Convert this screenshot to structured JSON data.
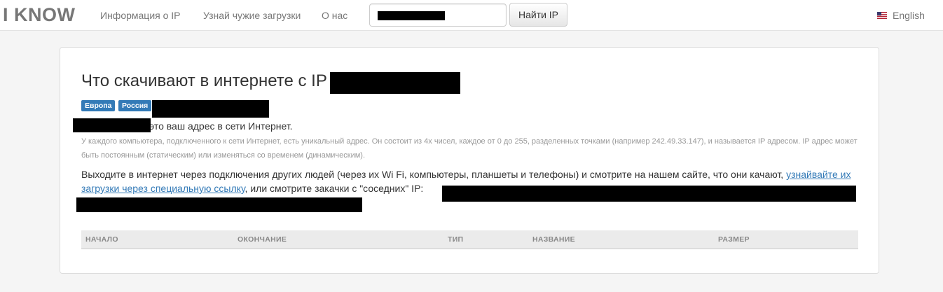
{
  "navbar": {
    "brand": "I KNOW",
    "links": [
      "Информация о IP",
      "Узнай чужие загрузки",
      "О нас"
    ],
    "search": {
      "value": "",
      "placeholder": ""
    },
    "search_button": "Найти IP",
    "language": "English",
    "language_icon": "us-flag-icon"
  },
  "main": {
    "title": "Что скачивают в интернете с IP",
    "badges": [
      "Европа",
      "Россия"
    ],
    "ip_line": "это ваш адрес в сети Интернет.",
    "explanation": "У каждого компьютера, подключенного к сети Интернет, есть уникальный адрес. Он состоит из 4х чисел, каждое от 0 до 255, разделенных точками (например 242.49.33.147), и называется IP адресом. IP адрес может быть постоянным (статическим) или изменяться со временем (динамическим).",
    "proxy_text_before": "Выходите в интернет через подключения других людей (через их Wi Fi, компьютеры, планшеты и телефоны) и смотрите на нашем сайте, что они качают, ",
    "proxy_link": "узнайвайте их загрузки через специальную ссылку",
    "proxy_text_after": ", или смотрите закачки с \"соседних\" IP:",
    "table": {
      "columns": [
        "НАЧАЛО",
        "ОКОНЧАНИЕ",
        "ТИП",
        "НАЗВАНИЕ",
        "РАЗМЕР"
      ],
      "rows": []
    }
  },
  "colors": {
    "accent": "#337ab7",
    "muted": "#999999",
    "background": "#f5f5f5"
  }
}
